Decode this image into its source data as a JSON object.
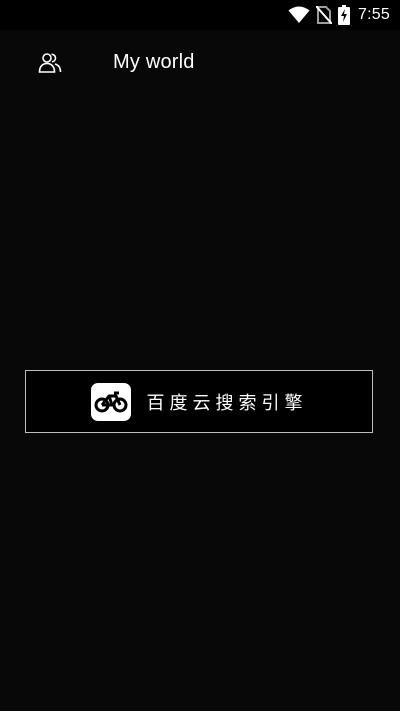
{
  "status_bar": {
    "time": "7:55",
    "icons": [
      "wifi-icon",
      "no-sim-icon",
      "battery-charging-icon"
    ]
  },
  "header": {
    "title": "My world",
    "left_icon": "users-icon"
  },
  "app_card": {
    "name": "百度云搜索引擎",
    "logo_icon": "bicycle-icon"
  }
}
